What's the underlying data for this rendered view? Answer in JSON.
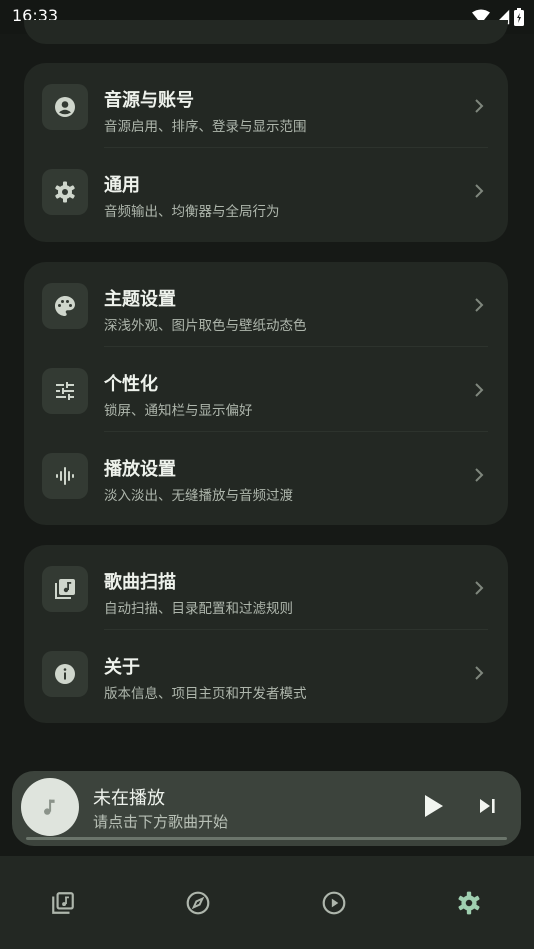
{
  "status_bar": {
    "time": "16:33"
  },
  "groups": [
    {
      "items": [
        {
          "icon": "account-circle-icon",
          "title": "音源与账号",
          "subtitle": "音源启用、排序、登录与显示范围"
        },
        {
          "icon": "gear-icon",
          "title": "通用",
          "subtitle": "音频输出、均衡器与全局行为"
        }
      ]
    },
    {
      "items": [
        {
          "icon": "palette-icon",
          "title": "主题设置",
          "subtitle": "深浅外观、图片取色与壁纸动态色"
        },
        {
          "icon": "tune-icon",
          "title": "个性化",
          "subtitle": "锁屏、通知栏与显示偏好"
        },
        {
          "icon": "waveform-icon",
          "title": "播放设置",
          "subtitle": "淡入淡出、无缝播放与音频过渡"
        }
      ]
    },
    {
      "items": [
        {
          "icon": "music-library-icon",
          "title": "歌曲扫描",
          "subtitle": "自动扫描、目录配置和过滤规则"
        },
        {
          "icon": "info-icon",
          "title": "关于",
          "subtitle": "版本信息、项目主页和开发者模式"
        }
      ]
    }
  ],
  "mini_player": {
    "title": "未在播放",
    "subtitle": "请点击下方歌曲开始",
    "progress": 0
  },
  "bottom_nav": {
    "tabs": [
      {
        "icon": "library-icon",
        "selected": false
      },
      {
        "icon": "compass-icon",
        "selected": false
      },
      {
        "icon": "play-circle-icon",
        "selected": false
      },
      {
        "icon": "gear-icon",
        "selected": true
      }
    ]
  },
  "colors": {
    "background": "#161916",
    "card": "#232823",
    "accent": "#9fcfb0"
  }
}
